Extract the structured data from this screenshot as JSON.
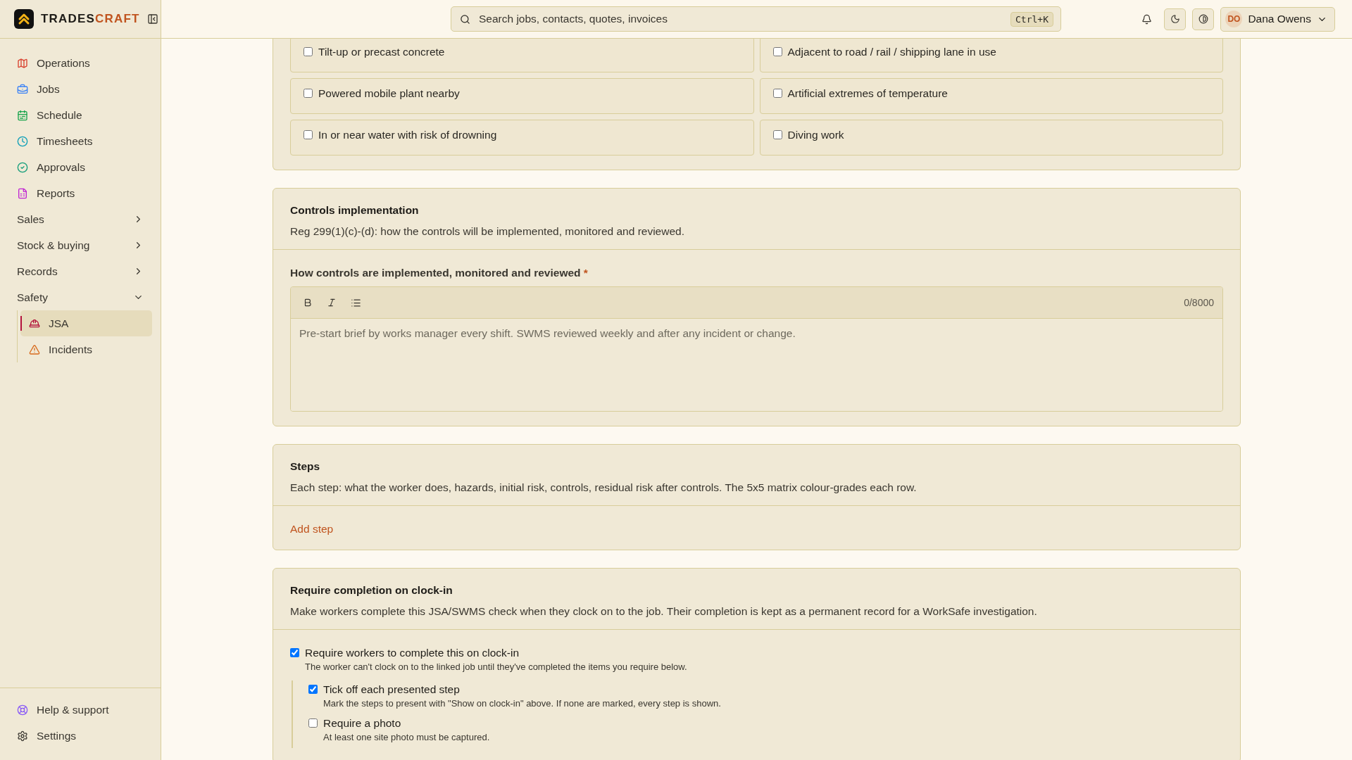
{
  "brand": {
    "first": "TRADES",
    "second": "CRAFT"
  },
  "sidebar": {
    "items": [
      {
        "kind": "link",
        "label": "Operations",
        "selected": false
      },
      {
        "kind": "link",
        "label": "Jobs",
        "selected": false
      },
      {
        "kind": "link",
        "label": "Schedule",
        "selected": false
      },
      {
        "kind": "link",
        "label": "Timesheets",
        "selected": false
      },
      {
        "kind": "link",
        "label": "Approvals",
        "selected": false
      },
      {
        "kind": "link",
        "label": "Reports",
        "selected": false
      },
      {
        "kind": "group",
        "label": "Sales",
        "expanded": false
      },
      {
        "kind": "group",
        "label": "Stock & buying",
        "expanded": false
      },
      {
        "kind": "group",
        "label": "Records",
        "expanded": false
      },
      {
        "kind": "group",
        "label": "Safety",
        "expanded": true,
        "children": [
          {
            "label": "JSA",
            "selected": true
          },
          {
            "label": "Incidents",
            "selected": false
          }
        ]
      }
    ],
    "footer": [
      {
        "label": "Help & support"
      },
      {
        "label": "Settings"
      }
    ]
  },
  "topbar": {
    "search": {
      "placeholder": "Search jobs, contacts, quotes, invoices",
      "shortcut": "Ctrl+K"
    },
    "user": {
      "initials": "DO",
      "name": "Dana Owens"
    }
  },
  "hazards": [
    {
      "label": "Tilt-up or precast concrete",
      "checked": false
    },
    {
      "label": "Adjacent to road / rail / shipping lane in use",
      "checked": false
    },
    {
      "label": "Powered mobile plant nearby",
      "checked": false
    },
    {
      "label": "Artificial extremes of temperature",
      "checked": false
    },
    {
      "label": "In or near water with risk of drowning",
      "checked": false
    },
    {
      "label": "Diving work",
      "checked": false
    }
  ],
  "controls": {
    "title": "Controls implementation",
    "description": "Reg 299(1)(c)-(d): how the controls will be implemented, monitored and reviewed.",
    "field": {
      "label": "How controls are implemented, monitored and reviewed",
      "required_mark": "*",
      "counter": "0/8000",
      "placeholder": "Pre-start brief by works manager every shift. SWMS reviewed weekly and after any incident or change."
    }
  },
  "steps": {
    "title": "Steps",
    "description": "Each step: what the worker does, hazards, initial risk, controls, residual risk after controls. The 5x5 matrix colour-grades each row.",
    "add_label": "Add step"
  },
  "clock_in": {
    "title": "Require completion on clock-in",
    "description": "Make workers complete this JSA/SWMS check when they clock on to the job. Their completion is kept as a permanent record for a WorkSafe investigation.",
    "options": [
      {
        "label": "Require workers to complete this on clock-in",
        "hint": "The worker can't clock on to the linked job until they've completed the items you require below.",
        "checked": true,
        "children": [
          {
            "label": "Tick off each presented step",
            "hint": "Mark the steps to present with \"Show on clock-in\" above. If none are marked, every step is shown.",
            "checked": true
          },
          {
            "label": "Require a photo",
            "hint": "At least one site photo must be captured.",
            "checked": false
          }
        ]
      }
    ]
  }
}
